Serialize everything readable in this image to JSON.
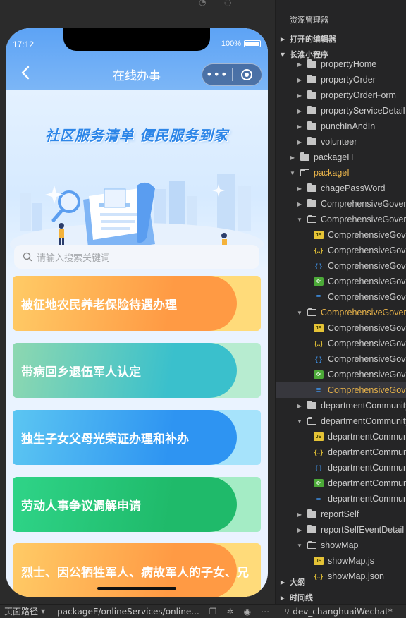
{
  "simulator": {
    "status_time": "17:12",
    "battery_text": "100%",
    "nav_title": "在线办事",
    "capsule_dots": "•••",
    "banner_title": "社区服务清单  便民服务到家",
    "search_placeholder": "请输入搜索关键词",
    "cards": [
      {
        "label": "被征地农民养老保险待遇办理",
        "color_main": "#ff9a44",
        "color_light": "#ffcb66",
        "color_right": "#ffdb7a"
      },
      {
        "label": "带病回乡退伍军人认定",
        "color_main": "#3ac0cc",
        "color_light": "#8ed8b0",
        "color_right": "#b7ecd0"
      },
      {
        "label": "独生子女父母光荣证办理和补办",
        "color_main": "#2e94f2",
        "color_light": "#5cc6f2",
        "color_right": "#a6e3fb"
      },
      {
        "label": "劳动人事争议调解申请",
        "color_main": "#1fba6a",
        "color_light": "#2fd488",
        "color_right": "#a4ecc5"
      },
      {
        "label": "烈士、因公牺牲军人、病故军人的子女、兄",
        "color_main": "#ff9a44",
        "color_light": "#ffcb66",
        "color_right": "#ffdb7a"
      }
    ]
  },
  "explorer": {
    "title": "资源管理器",
    "sections": {
      "open_editors": "打开的编辑器",
      "project": "长淮小程序",
      "outline": "大纲",
      "timeline": "时间线"
    },
    "tree": [
      {
        "label": "propertyHome",
        "type": "folder",
        "depth": 3,
        "open": false
      },
      {
        "label": "propertyOrder",
        "type": "folder",
        "depth": 3,
        "open": false
      },
      {
        "label": "propertyOrderForm",
        "type": "folder",
        "depth": 3,
        "open": false
      },
      {
        "label": "propertyServiceDetail",
        "type": "folder",
        "depth": 3,
        "open": false
      },
      {
        "label": "punchInAndIn",
        "type": "folder",
        "depth": 3,
        "open": false
      },
      {
        "label": "volunteer",
        "type": "folder",
        "depth": 3,
        "open": false
      },
      {
        "label": "packageH",
        "type": "folder",
        "depth": 2,
        "open": false
      },
      {
        "label": "packageI",
        "type": "folder",
        "depth": 2,
        "open": true,
        "style": "hl2"
      },
      {
        "label": "chagePassWord",
        "type": "folder",
        "depth": 3,
        "open": false
      },
      {
        "label": "ComprehensiveGovernance",
        "type": "folder",
        "depth": 3,
        "open": false
      },
      {
        "label": "ComprehensiveGovernance",
        "type": "folder",
        "depth": 3,
        "open": true
      },
      {
        "label": "ComprehensiveGovernance",
        "type": "js",
        "depth": 4
      },
      {
        "label": "ComprehensiveGovernance",
        "type": "json",
        "depth": 4
      },
      {
        "label": "ComprehensiveGovernance",
        "type": "wxml",
        "depth": 4
      },
      {
        "label": "ComprehensiveGovernance",
        "type": "wxs",
        "depth": 4
      },
      {
        "label": "ComprehensiveGovernance",
        "type": "wxss",
        "depth": 4
      },
      {
        "label": "ComprehensiveGovernance",
        "type": "folder",
        "depth": 3,
        "open": true,
        "style": "hl2"
      },
      {
        "label": "ComprehensiveGovernance",
        "type": "js",
        "depth": 4
      },
      {
        "label": "ComprehensiveGovernance",
        "type": "json",
        "depth": 4
      },
      {
        "label": "ComprehensiveGovernance",
        "type": "wxml",
        "depth": 4
      },
      {
        "label": "ComprehensiveGovernance",
        "type": "wxs",
        "depth": 4
      },
      {
        "label": "ComprehensiveGovernance",
        "type": "wxss",
        "depth": 4,
        "selected": true,
        "style": "hl2"
      },
      {
        "label": "departmentCommunity",
        "type": "folder",
        "depth": 3,
        "open": false
      },
      {
        "label": "departmentCommunity",
        "type": "folder",
        "depth": 3,
        "open": true
      },
      {
        "label": "departmentCommunity",
        "type": "js",
        "depth": 4
      },
      {
        "label": "departmentCommunity",
        "type": "json",
        "depth": 4
      },
      {
        "label": "departmentCommunity",
        "type": "wxml",
        "depth": 4
      },
      {
        "label": "departmentCommunity",
        "type": "wxs",
        "depth": 4
      },
      {
        "label": "departmentCommunity",
        "type": "wxss",
        "depth": 4
      },
      {
        "label": "reportSelf",
        "type": "folder",
        "depth": 3,
        "open": false
      },
      {
        "label": "reportSelfEventDetail",
        "type": "folder",
        "depth": 3,
        "open": false
      },
      {
        "label": "showMap",
        "type": "folder",
        "depth": 3,
        "open": true
      },
      {
        "label": "showMap.js",
        "type": "js",
        "depth": 4
      },
      {
        "label": "showMap.json",
        "type": "json",
        "depth": 4
      }
    ]
  },
  "statusbar": {
    "path_label": "页面路径",
    "path": "packageE/onlineServices/online...",
    "branch": "dev_changhuaiWechat*"
  }
}
